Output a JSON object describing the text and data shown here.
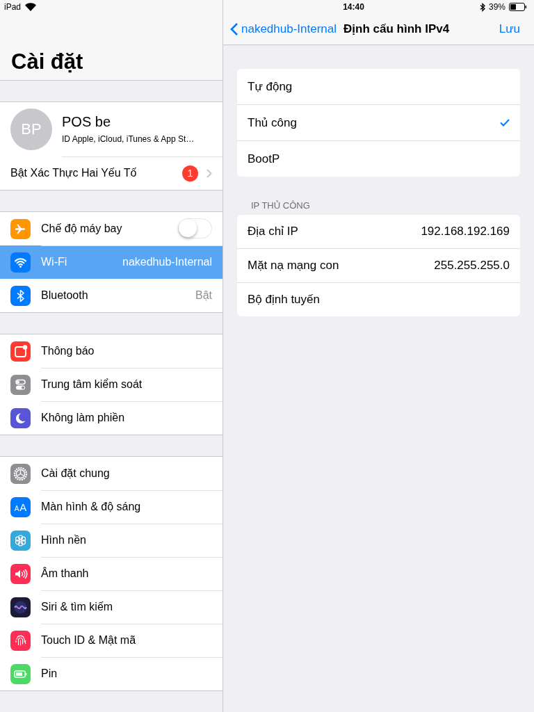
{
  "status_bar": {
    "device": "iPad",
    "time": "14:40",
    "battery": "39%"
  },
  "sidebar": {
    "title": "Cài đặt",
    "profile": {
      "initials": "BP",
      "name": "POS be",
      "subtitle": "ID Apple, iCloud, iTunes & App St…"
    },
    "two_factor": {
      "label": "Bật Xác Thực Hai Yếu Tố",
      "badge": "1"
    },
    "groups": [
      {
        "items": [
          {
            "kind": "toggle",
            "label": "Chế độ máy bay",
            "on": false,
            "selected": false
          },
          {
            "kind": "value",
            "label": "Wi-Fi",
            "value": "nakedhub-Internal",
            "selected": true
          },
          {
            "kind": "value",
            "label": "Bluetooth",
            "value": "Bật",
            "selected": false
          }
        ]
      },
      {
        "items": [
          {
            "kind": "link",
            "label": "Thông báo",
            "selected": false
          },
          {
            "kind": "link",
            "label": "Trung tâm kiểm soát",
            "selected": false
          },
          {
            "kind": "link",
            "label": "Không làm phiền",
            "selected": false
          }
        ]
      },
      {
        "items": [
          {
            "kind": "link",
            "label": "Cài đặt chung",
            "selected": false
          },
          {
            "kind": "link",
            "label": "Màn hình & độ sáng",
            "icon_text": "AA",
            "selected": false
          },
          {
            "kind": "link",
            "label": "Hình nền",
            "selected": false
          },
          {
            "kind": "link",
            "label": "Âm thanh",
            "selected": false
          },
          {
            "kind": "link",
            "label": "Siri & tìm kiếm",
            "selected": false
          },
          {
            "kind": "link",
            "label": "Touch ID & Mật mã",
            "selected": false
          },
          {
            "kind": "link",
            "label": "Pin",
            "selected": false
          }
        ]
      }
    ]
  },
  "detail": {
    "back": "nakedhub-Internal",
    "title": "Định cấu hình IPv4",
    "action": "Lưu",
    "modes": [
      {
        "label": "Tự động",
        "selected": false
      },
      {
        "label": "Thủ công",
        "selected": true
      },
      {
        "label": "BootP",
        "selected": false
      }
    ],
    "section_header": "IP THỦ CÔNG",
    "fields": [
      {
        "label": "Địa chỉ IP",
        "value": "192.168.192.169"
      },
      {
        "label": "Mặt nạ mạng con",
        "value": "255.255.255.0"
      },
      {
        "label": "Bộ định tuyến"
      }
    ]
  }
}
